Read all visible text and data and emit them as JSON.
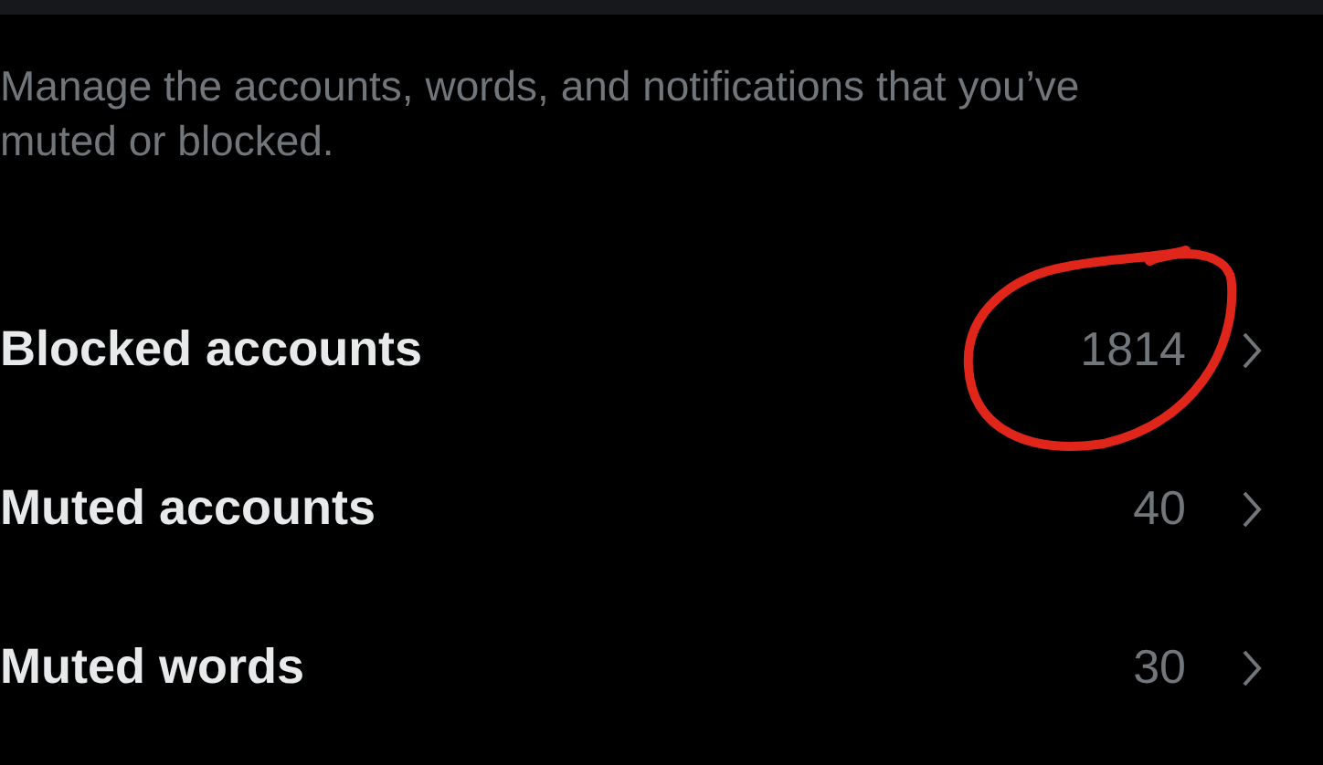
{
  "description": "Manage the accounts, words, and notifications that you’ve muted or blocked.",
  "rows": [
    {
      "label": "Blocked accounts",
      "count": "1814",
      "circled": true
    },
    {
      "label": "Muted accounts",
      "count": "40",
      "circled": false
    },
    {
      "label": "Muted words",
      "count": "30",
      "circled": false
    }
  ]
}
